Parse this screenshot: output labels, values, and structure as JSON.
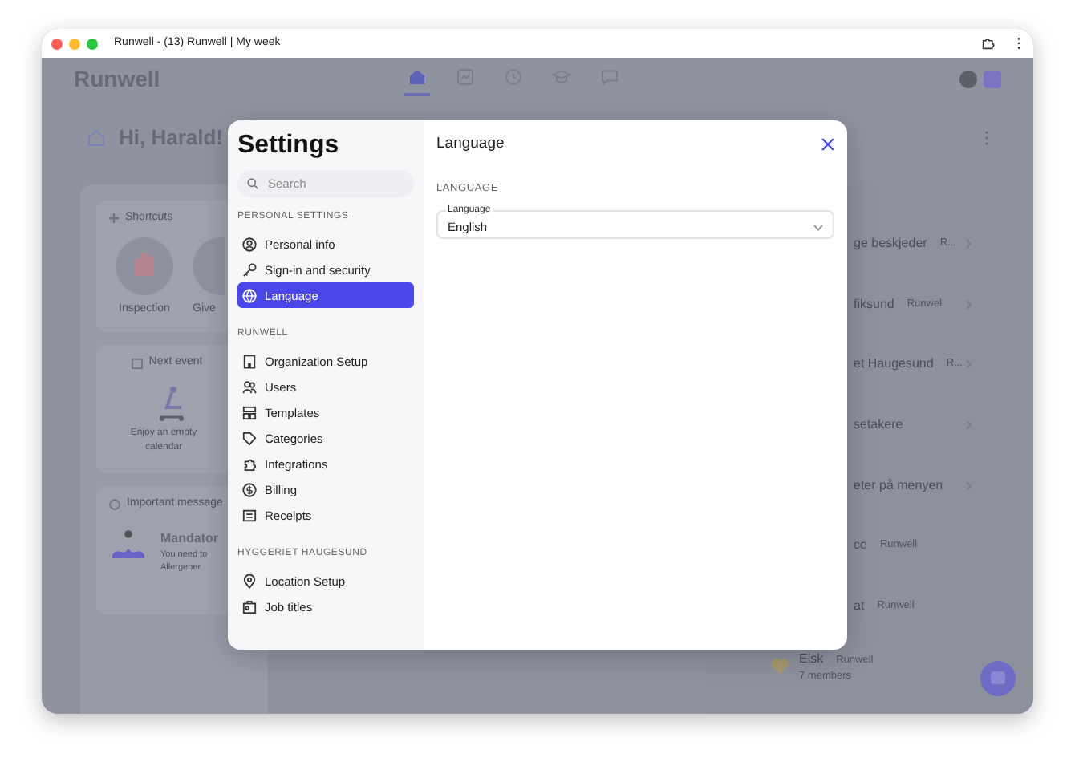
{
  "browser": {
    "title": "Runwell - (13) Runwell | My week"
  },
  "app": {
    "logo": "Runwell",
    "nav": [
      {
        "selected": true
      },
      {
        "selected": false
      },
      {
        "selected": false
      },
      {
        "selected": false
      },
      {
        "selected": false
      }
    ],
    "greeting": "Hi, Harald!",
    "shortcuts": {
      "title": "Shortcuts",
      "items": [
        {
          "label": "Inspection"
        },
        {
          "label": "Give"
        }
      ]
    },
    "next_event": {
      "title": "Next event",
      "empty_text": "Enjoy an empty calendar"
    },
    "messages": {
      "title": "Important message",
      "message_title": "Mandator",
      "message_text": "You need to",
      "message_sub": "Allergener"
    },
    "channels": [
      {
        "kind": "cut",
        "name": "ge beskjeder",
        "meta": "R..."
      },
      {
        "kind": "cut",
        "name": "fiksund",
        "meta": "Runwell"
      },
      {
        "kind": "cut",
        "name": "et Haugesund",
        "meta": "R..."
      },
      {
        "kind": "cut",
        "name": "setakere"
      },
      {
        "kind": "cut",
        "name": "eter på menyen"
      },
      {
        "kind": "cut",
        "name": "ce",
        "meta": "Runwell"
      },
      {
        "kind": "cut",
        "name": "at",
        "meta": "Runwell"
      },
      {
        "kind": "full",
        "name": "Elsk",
        "meta": "Runwell",
        "sub": "7 members"
      }
    ]
  },
  "modal": {
    "title": "Settings",
    "search": {
      "placeholder": "Search"
    },
    "nav_sections": [
      {
        "heading": "PERSONAL SETTINGS",
        "items": [
          {
            "label": "Personal info",
            "selected": false
          },
          {
            "label": "Sign-in and security",
            "selected": false
          },
          {
            "label": "Language",
            "selected": true
          }
        ]
      },
      {
        "heading": "RUNWELL",
        "items": [
          {
            "label": "Organization Setup",
            "selected": false
          },
          {
            "label": "Users",
            "selected": false
          },
          {
            "label": "Templates",
            "selected": false
          },
          {
            "label": "Categories",
            "selected": false
          },
          {
            "label": "Integrations",
            "selected": false
          },
          {
            "label": "Billing",
            "selected": false
          },
          {
            "label": "Receipts",
            "selected": false
          }
        ]
      },
      {
        "heading": "HYGGERIET HAUGESUND",
        "items": [
          {
            "label": "Location Setup",
            "selected": false
          },
          {
            "label": "Job titles",
            "selected": false
          }
        ]
      }
    ],
    "pane_title": "Language",
    "section_label": "LANGUAGE",
    "field": {
      "label": "Language",
      "value": "English"
    }
  }
}
